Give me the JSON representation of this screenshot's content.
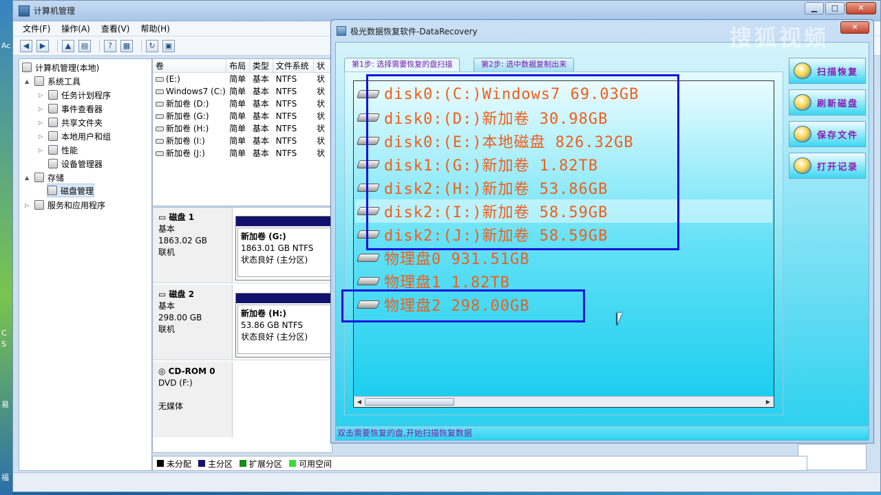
{
  "desktop_edge": {
    "label_a": "Ac",
    "label_b": "C",
    "label_c": "S",
    "label_d": "易",
    "label_e": "福"
  },
  "mmc": {
    "title": "计算机管理",
    "menu": [
      "文件(F)",
      "操作(A)",
      "查看(V)",
      "帮助(H)"
    ],
    "tree": [
      {
        "label": "计算机管理(本地)",
        "level": 0,
        "arrow": ""
      },
      {
        "label": "系统工具",
        "level": 1,
        "arrow": "▲"
      },
      {
        "label": "任务计划程序",
        "level": 2,
        "arrow": "▷"
      },
      {
        "label": "事件查看器",
        "level": 2,
        "arrow": "▷"
      },
      {
        "label": "共享文件夹",
        "level": 2,
        "arrow": "▷"
      },
      {
        "label": "本地用户和组",
        "level": 2,
        "arrow": "▷"
      },
      {
        "label": "性能",
        "level": 2,
        "arrow": "▷"
      },
      {
        "label": "设备管理器",
        "level": 2,
        "arrow": ""
      },
      {
        "label": "存储",
        "level": 1,
        "arrow": "▲"
      },
      {
        "label": "磁盘管理",
        "level": 2,
        "arrow": ""
      },
      {
        "label": "服务和应用程序",
        "level": 1,
        "arrow": "▷"
      }
    ],
    "volume_columns": [
      "卷",
      "布局",
      "类型",
      "文件系统",
      "状"
    ],
    "volumes": [
      [
        "(E:)",
        "简单",
        "基本",
        "NTFS",
        "状"
      ],
      [
        "Windows7 (C:)",
        "简单",
        "基本",
        "NTFS",
        "状"
      ],
      [
        "新加卷 (D:)",
        "简单",
        "基本",
        "NTFS",
        "状"
      ],
      [
        "新加卷 (G:)",
        "简单",
        "基本",
        "NTFS",
        "状"
      ],
      [
        "新加卷 (H:)",
        "简单",
        "基本",
        "NTFS",
        "状"
      ],
      [
        "新加卷 (I:)",
        "简单",
        "基本",
        "NTFS",
        "状"
      ],
      [
        "新加卷 (J:)",
        "简单",
        "基本",
        "NTFS",
        "状"
      ]
    ],
    "disks": [
      {
        "name": "磁盘 1",
        "type": "基本",
        "size": "1863.02 GB",
        "state": "联机",
        "part_name": "新加卷  (G:)",
        "part_size": "1863.01 GB NTFS",
        "part_state": "状态良好 (主分区)"
      },
      {
        "name": "磁盘 2",
        "type": "基本",
        "size": "298.00 GB",
        "state": "联机",
        "part_name": "新加卷  (H:)",
        "part_size": "53.86 GB NTFS",
        "part_state": "状态良好 (主分区)"
      }
    ],
    "cdrom": {
      "name": "CD-ROM 0",
      "drive": "DVD (F:)",
      "media": "无媒体"
    },
    "legend": [
      {
        "label": "未分配",
        "color": "#000000"
      },
      {
        "label": "主分区",
        "color": "#12126e"
      },
      {
        "label": "扩展分区",
        "color": "#1a8a1a"
      },
      {
        "label": "可用空间",
        "color": "#35e035"
      }
    ]
  },
  "recovery": {
    "title": "极光数据恢复软件-DataRecovery",
    "tab1": "第1步: 选择需要恢复的盘扫描",
    "tab2": "第2步: 选中数据复制出来",
    "items": [
      "disk0:(C:)Windows7 69.03GB",
      "disk0:(D:)新加卷 30.98GB",
      "disk0:(E:)本地磁盘 826.32GB",
      "disk1:(G:)新加卷 1.82TB",
      "disk2:(H:)新加卷 53.86GB",
      "disk2:(I:)新加卷 58.59GB",
      "disk2:(J:)新加卷 58.59GB",
      "物理盘0 931.51GB",
      "物理盘1 1.82TB",
      "物理盘2 298.00GB"
    ],
    "buttons": [
      "扫描恢复",
      "刷新磁盘",
      "保存文件",
      "打开记录"
    ],
    "status": "双击需要恢复的盘,开始扫描恢复数据"
  },
  "watermark": "搜狐视频"
}
